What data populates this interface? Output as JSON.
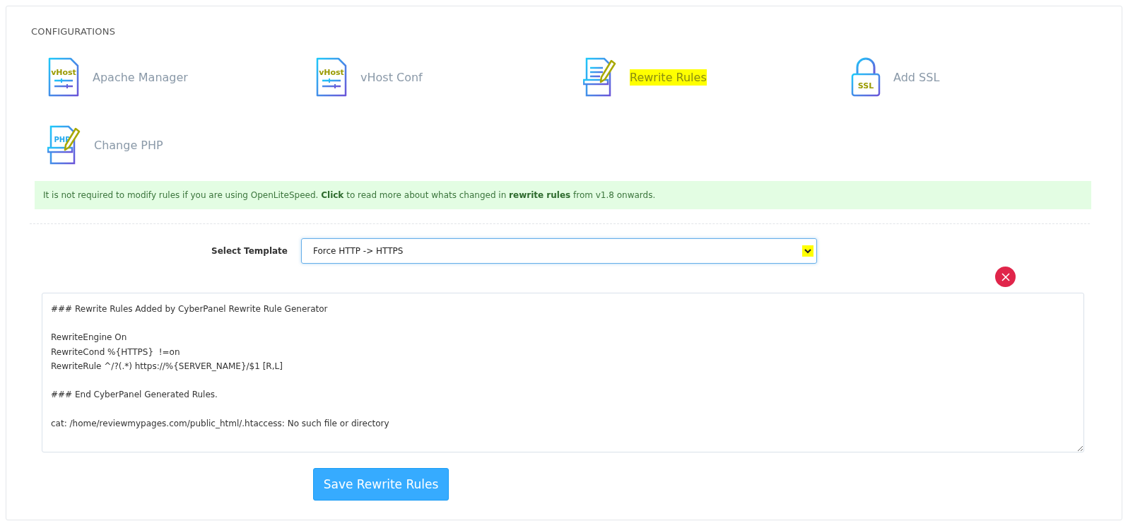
{
  "section_title": "CONFIGURATIONS",
  "items": [
    {
      "label": "Apache Manager",
      "kind": "vhost",
      "icon_text": "vHost",
      "highlighted": false
    },
    {
      "label": "vHost Conf",
      "kind": "vhost",
      "icon_text": "vHost",
      "highlighted": false
    },
    {
      "label": "Rewrite Rules",
      "kind": "rewrite",
      "highlighted": true
    },
    {
      "label": "Add SSL",
      "kind": "ssl",
      "icon_text": "SSL",
      "highlighted": false
    },
    {
      "label": "Change PHP",
      "kind": "php",
      "icon_text": "PHP",
      "highlighted": false
    }
  ],
  "notice": "It is not required to modify rules if you are using OpenLiteSpeed. **Click** to read more about whats changed in **rewrite rules** from v1.8 onwards.",
  "template": {
    "label": "Select Template",
    "value": "Force HTTP -> HTTPS",
    "arrow_highlighted": true
  },
  "rules": "### Rewrite Rules Added by CyberPanel Rewrite Rule Generator\n\nRewriteEngine On\nRewriteCond %{HTTPS}  !=on\nRewriteRule ^/?(.*) https://%{SERVER_NAME}/$1 [R,L]\n\n### End CyberPanel Generated Rules.\n\ncat: /home/reviewmypages.com/public_html/.htaccess: No such file or directory",
  "save_button": "Save Rewrite Rules"
}
